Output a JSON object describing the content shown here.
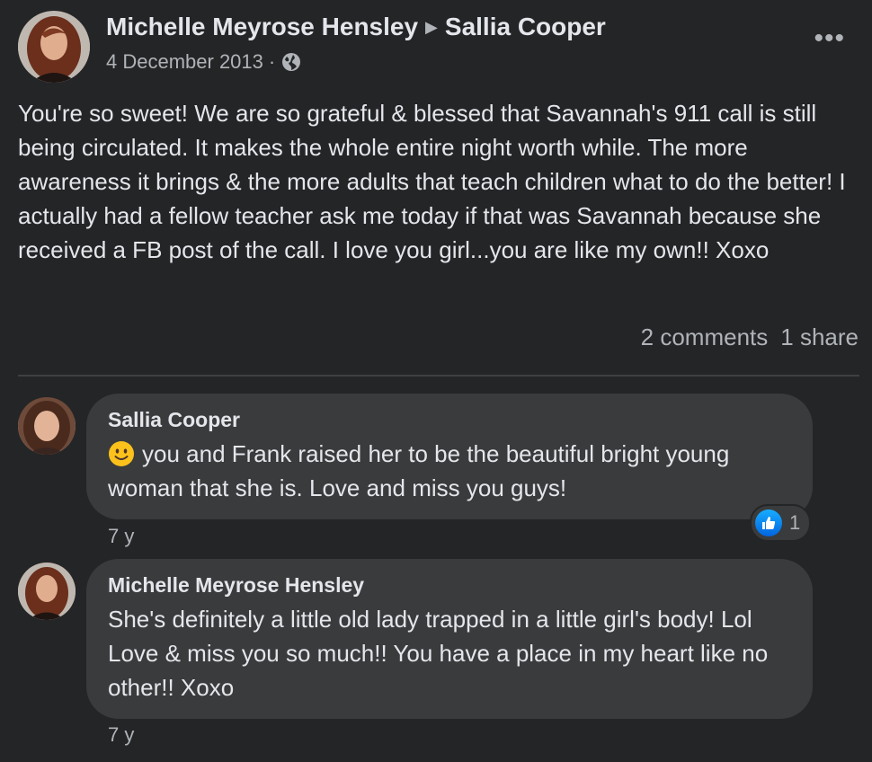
{
  "post": {
    "author": "Michelle Meyrose Hensley",
    "target": "Sallia Cooper",
    "date": "4 December 2013",
    "separator": "·",
    "privacy_icon": "globe-icon",
    "more_icon": "•••",
    "text": "You're so sweet! We are so grateful & blessed that Savannah's 911 call is still being circulated.  It makes the whole entire night worth while. The more awareness it brings & the more adults that teach children what to do the better! I actually had a fellow teacher ask me today if that was Savannah because she received a FB post of the call.  I love you girl...you are like my own!! Xoxo",
    "comments_count": "2 comments",
    "shares_count": "1 share"
  },
  "comments": [
    {
      "author": "Sallia Cooper",
      "emoji": "slightly-smiling-face",
      "text": "you and Frank raised her to be the beautiful bright young woman that she is. Love and miss you guys!",
      "time": "7 y",
      "reaction_icon": "like-icon",
      "reaction_count": "1"
    },
    {
      "author": "Michelle Meyrose Hensley",
      "text": "She's definitely a little old lady trapped in a little girl's body! Lol Love & miss you so much!! You have a place in my heart like no other!! Xoxo",
      "time": "7 y"
    }
  ],
  "colors": {
    "background": "#242526",
    "bubble": "#3a3b3c",
    "primary_text": "#e4e6eb",
    "secondary_text": "#b0b3b8",
    "like_blue": "#0165e1"
  }
}
